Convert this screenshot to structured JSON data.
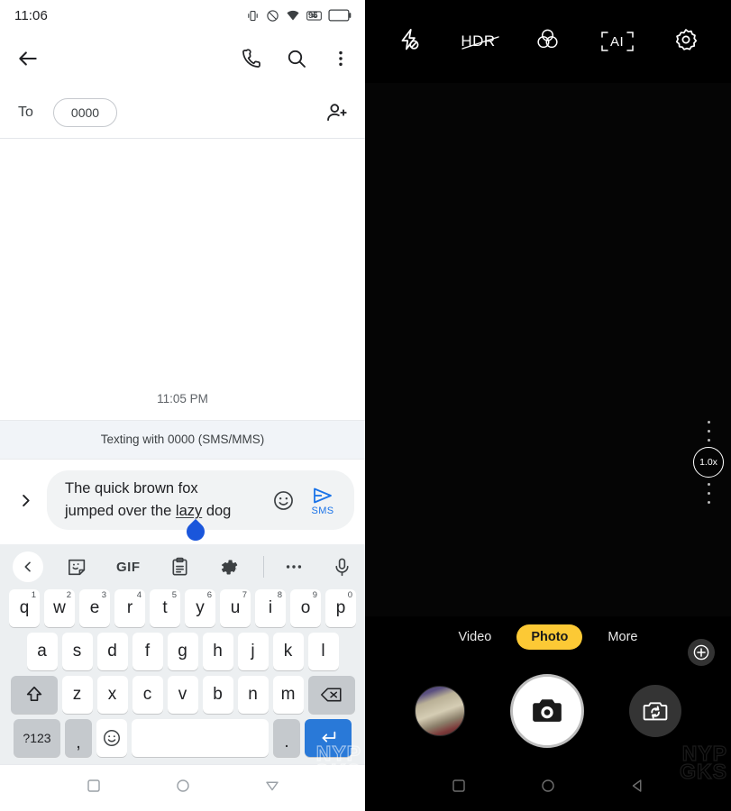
{
  "left_phone": {
    "status_bar": {
      "time": "11:06",
      "battery_level": "95",
      "icons": [
        "vibrate-icon",
        "do-not-disturb-icon",
        "wifi-icon",
        "no-sim-icon",
        "battery-icon"
      ]
    },
    "app_bar": {
      "back": "back-arrow-icon",
      "call": "phone-icon",
      "search": "search-icon",
      "overflow": "more-vertical-icon"
    },
    "recipient_row": {
      "to_label": "To",
      "chip_value": "0000",
      "add_contact": "add-person-icon"
    },
    "thread": {
      "timestamp": "11:05 PM",
      "sms_banner": "Texting with 0000 (SMS/MMS)"
    },
    "composer": {
      "expand_icon": "chevron-right-icon",
      "text_line1": "The quick brown fox",
      "text_line2_pre": "jumped over the ",
      "text_line2_misspell": "lazy",
      "text_line2_post": " dog",
      "emoji_icon": "emoji-smiley-icon",
      "send_icon": "send-plane-icon",
      "send_label": "SMS",
      "accent_color": "#1a73e8"
    },
    "keyboard": {
      "toolbar": [
        "back-chevron-icon",
        "sticker-icon",
        "GIF",
        "clipboard-icon",
        "settings-gear-icon",
        "more-horizontal-icon",
        "microphone-icon"
      ],
      "gif_label": "GIF",
      "row1": [
        {
          "key": "q",
          "num": "1"
        },
        {
          "key": "w",
          "num": "2"
        },
        {
          "key": "e",
          "num": "3"
        },
        {
          "key": "r",
          "num": "4"
        },
        {
          "key": "t",
          "num": "5"
        },
        {
          "key": "y",
          "num": "6"
        },
        {
          "key": "u",
          "num": "7"
        },
        {
          "key": "i",
          "num": "8"
        },
        {
          "key": "o",
          "num": "9"
        },
        {
          "key": "p",
          "num": "0"
        }
      ],
      "row2": [
        "a",
        "s",
        "d",
        "f",
        "g",
        "h",
        "j",
        "k",
        "l"
      ],
      "row3": [
        "z",
        "x",
        "c",
        "v",
        "b",
        "n",
        "m"
      ],
      "shift_label": "shift-icon",
      "delete_label": "backspace-icon",
      "sym_label": "?123",
      "comma_label": ",",
      "emoji_key": "emoji-key-icon",
      "space_label": "",
      "period_label": ".",
      "enter_label": "enter-icon"
    },
    "nav_bar": {
      "recents": "square-icon",
      "home": "circle-icon",
      "back": "triangle-down-icon"
    },
    "watermark": "NYP\nGKS"
  },
  "right_phone": {
    "top_bar": [
      {
        "name": "flash-off-icon"
      },
      {
        "name": "hdr-off-icon",
        "label": "HDR"
      },
      {
        "name": "color-filter-icon"
      },
      {
        "name": "ai-scene-icon",
        "label": "AI"
      },
      {
        "name": "settings-gear-icon"
      }
    ],
    "zoom": {
      "level": "1.0x"
    },
    "beauty_icon": "beauty-effect-icon",
    "modes": [
      {
        "label": "Video",
        "active": false
      },
      {
        "label": "Photo",
        "active": true
      },
      {
        "label": "More",
        "active": false
      }
    ],
    "mode_active_color": "#fcc935",
    "actions": {
      "gallery": "gallery-thumbnail",
      "shutter": "camera-shutter-icon",
      "flip": "flip-camera-icon"
    },
    "nav_bar": {
      "recents": "square-icon",
      "home": "circle-icon",
      "back": "triangle-left-icon"
    },
    "watermark": "NYP\nGKS"
  }
}
